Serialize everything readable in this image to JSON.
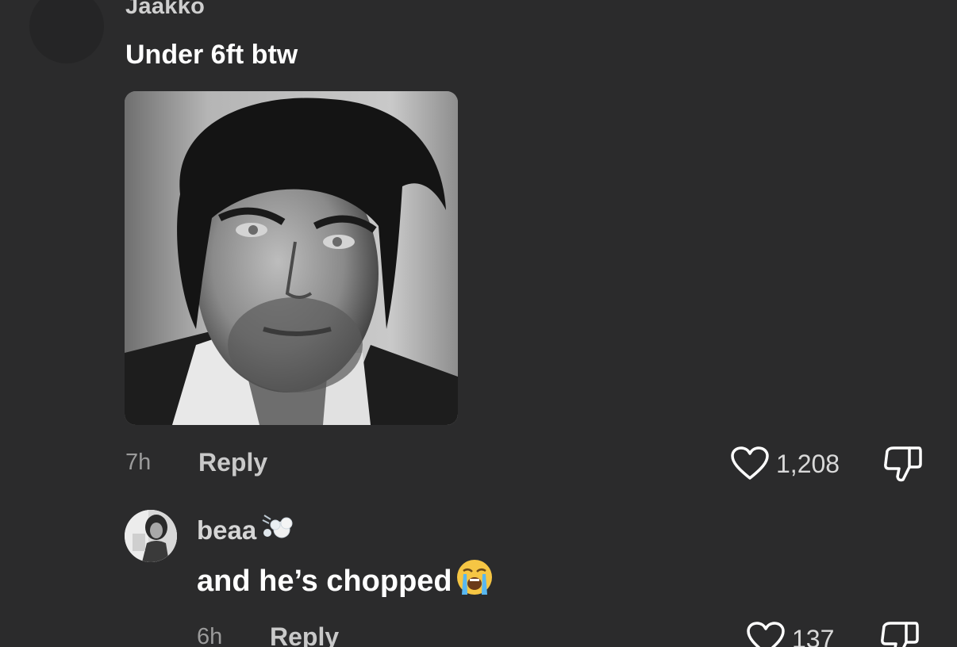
{
  "comment": {
    "username": "Jaakko",
    "text": "Under 6ft btw",
    "time": "7h",
    "reply_label": "Reply",
    "likes": "1,208"
  },
  "reply": {
    "username": "beaa",
    "username_emoji": "dashing-away-emoji",
    "text": "and he’s chopped",
    "text_emoji": "loudly-crying-face-emoji",
    "time": "6h",
    "reply_label": "Reply",
    "likes": "137"
  },
  "colors": {
    "background": "#2b2b2c",
    "primary_text": "#ffffff",
    "secondary_text": "#9b9b9b"
  }
}
